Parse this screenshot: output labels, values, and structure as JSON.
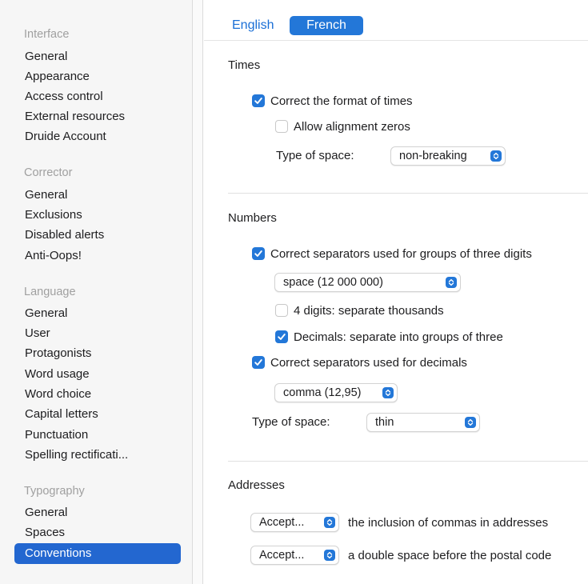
{
  "sidebar": {
    "groups": [
      {
        "heading": "Interface",
        "items": [
          "General",
          "Appearance",
          "Access control",
          "External resources",
          "Druide Account"
        ]
      },
      {
        "heading": "Corrector",
        "items": [
          "General",
          "Exclusions",
          "Disabled alerts",
          "Anti-Oops!"
        ]
      },
      {
        "heading": "Language",
        "items": [
          "General",
          "User",
          "Protagonists",
          "Word usage",
          "Word choice",
          "Capital letters",
          "Punctuation",
          "Spelling rectificati..."
        ]
      },
      {
        "heading": "Typography",
        "items": [
          "General",
          "Spaces",
          "Conventions"
        ]
      }
    ],
    "selected": "Conventions"
  },
  "tabs": {
    "english": "English",
    "french": "French",
    "active": "French"
  },
  "times": {
    "title": "Times",
    "correct_format": {
      "label": "Correct the format of times",
      "checked": true
    },
    "alignment_zeros": {
      "label": "Allow alignment zeros",
      "checked": false
    },
    "space_label": "Type of space:",
    "space_value": "non-breaking"
  },
  "numbers": {
    "title": "Numbers",
    "groups_of_three": {
      "label": "Correct separators used for groups of three digits",
      "checked": true
    },
    "group_separator_value": "space (12 000 000)",
    "four_digits": {
      "label": "4 digits: separate thousands",
      "checked": false
    },
    "decimals_groups": {
      "label": "Decimals: separate into groups of three",
      "checked": true
    },
    "decimal_separators": {
      "label": "Correct separators used for decimals",
      "checked": true
    },
    "decimal_separator_value": "comma (12,95)",
    "space_label": "Type of space:",
    "space_value": "thin"
  },
  "addresses": {
    "title": "Addresses",
    "commas": {
      "value": "Accept...",
      "text": "the inclusion of commas in addresses"
    },
    "double_space": {
      "value": "Accept...",
      "text": "a double space before the postal code"
    }
  },
  "colors": {
    "accent": "#2377d8",
    "selection": "#2367d0",
    "link_blue": "#1a6fd6",
    "sidebar_bg": "#f6f6f6"
  },
  "icons": {
    "checkbox_checked": "checkmark-icon",
    "popup_stepper": "up-down-chevron-icon"
  }
}
